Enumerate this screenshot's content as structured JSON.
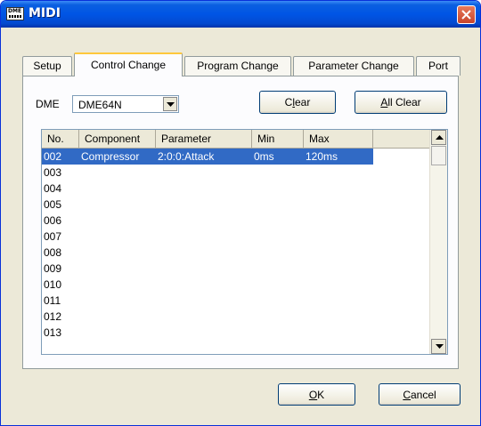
{
  "window": {
    "title": "MIDI",
    "icon_label": "DME"
  },
  "tabs": [
    {
      "label": "Setup"
    },
    {
      "label": "Control Change",
      "active": true
    },
    {
      "label": "Program Change"
    },
    {
      "label": "Parameter Change"
    },
    {
      "label": "Port"
    }
  ],
  "dme": {
    "label": "DME",
    "selected": "DME64N"
  },
  "buttons": {
    "clear_pre": "C",
    "clear_u": "l",
    "clear_post": "ear",
    "allclear_u": "A",
    "allclear_post": "ll Clear",
    "ok_u": "O",
    "ok_post": "K",
    "cancel_u": "C",
    "cancel_post": "ancel"
  },
  "table": {
    "columns": [
      "No.",
      "Component",
      "Parameter",
      "Min",
      "Max"
    ],
    "rows": [
      {
        "no": "002",
        "component": "Compressor",
        "parameter": "2:0:0:Attack",
        "min": "0ms",
        "max": "120ms",
        "selected": true
      },
      {
        "no": "003"
      },
      {
        "no": "004"
      },
      {
        "no": "005"
      },
      {
        "no": "006"
      },
      {
        "no": "007"
      },
      {
        "no": "008"
      },
      {
        "no": "009"
      },
      {
        "no": "010"
      },
      {
        "no": "011"
      },
      {
        "no": "012"
      },
      {
        "no": "013"
      }
    ]
  },
  "colors": {
    "title_bar": "#0055e5",
    "selection": "#316ac5",
    "dialog_bg": "#ece9d8",
    "active_tab_accent": "#ffc83c"
  }
}
